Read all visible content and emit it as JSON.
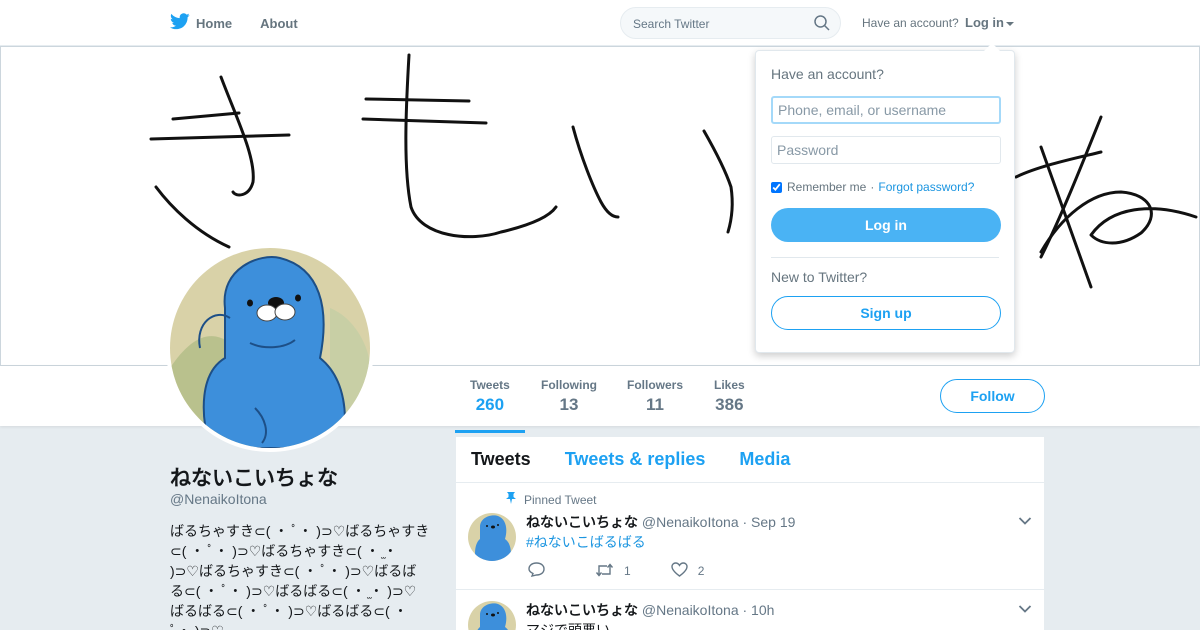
{
  "nav": {
    "home_label": "Home",
    "about_label": "About",
    "search_placeholder": "Search Twitter",
    "have_account": "Have an account?",
    "login_label": "Log in"
  },
  "profile": {
    "name": "ねないこいちょな",
    "handle": "@NenaikoItona",
    "bio": "ばるちゃすき⊂( ・ ﾟ・ )⊃♡ばるちゃすき⊂( ・ ﾟ・ )⊃♡ばるちゃすき⊂( ・ ̫・ )⊃♡ばるちゃすき⊂( ・ ﾟ・ )⊃♡ばるばる⊂( ・ ﾟ・ )⊃♡ばるばる⊂( ・ ̫・ )⊃♡ばるばる⊂( ・ ﾟ・ )⊃♡ばるばる⊂( ・ ﾟ・ )⊃♡",
    "follow_label": "Follow"
  },
  "stats": [
    {
      "label": "Tweets",
      "value": "260"
    },
    {
      "label": "Following",
      "value": "13"
    },
    {
      "label": "Followers",
      "value": "11"
    },
    {
      "label": "Likes",
      "value": "386"
    }
  ],
  "timeline": {
    "tabs": [
      "Tweets",
      "Tweets & replies",
      "Media"
    ],
    "tweets": [
      {
        "pinned_label": "Pinned Tweet",
        "name": "ねないこいちょな",
        "handle": "@NenaikoItona",
        "time": "· Sep 19",
        "text": "#ねないこばるばる",
        "retweets": "1",
        "likes": "2"
      },
      {
        "name": "ねないこいちょな",
        "handle": "@NenaikoItona",
        "time": "· 10h",
        "text": "マジで頭悪い"
      }
    ]
  },
  "login_dropdown": {
    "title": "Have an account?",
    "username_placeholder": "Phone, email, or username",
    "password_placeholder": "Password",
    "remember_label": "Remember me",
    "separator": "·",
    "forgot_label": "Forgot password?",
    "login_button": "Log in",
    "new_label": "New to Twitter?",
    "signup_button": "Sign up"
  },
  "colors": {
    "accent": "#1da1f2",
    "login_button": "#4ab3f4",
    "link": "#1b95e0"
  },
  "icons": [
    "twitter-bird-icon",
    "home-icon",
    "search-icon",
    "pin-icon",
    "reply-icon",
    "retweet-icon",
    "like-icon",
    "chevron-down-icon"
  ]
}
